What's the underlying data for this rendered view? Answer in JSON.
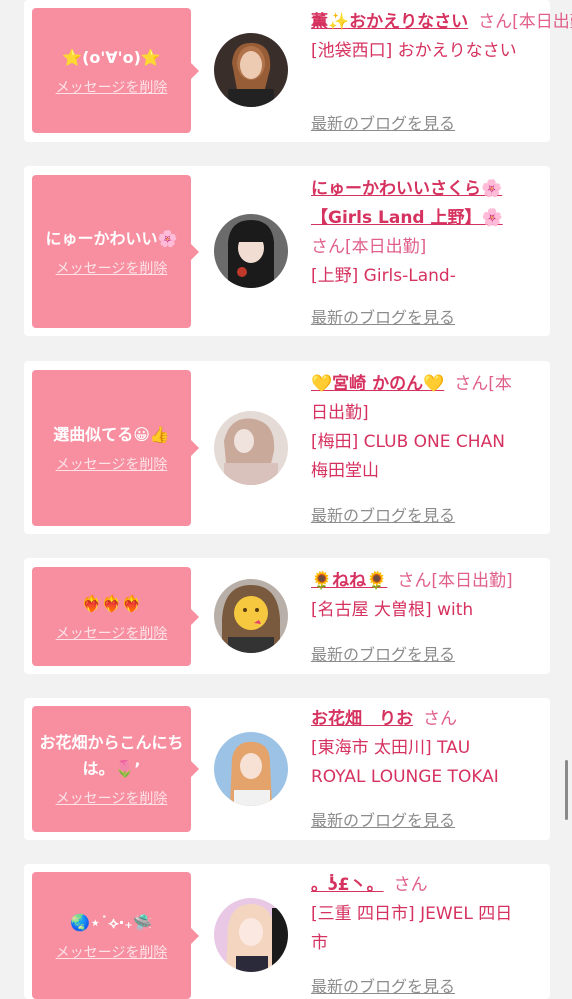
{
  "delete_label": "メッセージを削除",
  "blog_label": "最新のブログを見る",
  "san": "さん",
  "colors": {
    "accent": "#f78fa0",
    "name": "#d6325f",
    "background": "#f2f2f2"
  },
  "cards": [
    {
      "message": "⭐(o'∀'o)⭐",
      "name_lines": [
        "薫✨おかえりなさい"
      ],
      "info_lines": [
        "さん[本日出勤]",
        "[池袋西口] おかえりなさい"
      ]
    },
    {
      "message": "にゅーかわいい🌸",
      "name_lines": [
        "にゅーかわいいさくら🌸",
        "【Girls Land 上野】🌸"
      ],
      "info_lines": [
        "さん[本日出勤]",
        "[上野] Girls-Land-"
      ]
    },
    {
      "message": "選曲似てる😀👍",
      "name_lines": [
        "💛宮崎 かのん💛"
      ],
      "info_lines": [
        "さん[本",
        "日出勤]",
        "[梅田] CLUB ONE CHAN",
        "梅田堂山"
      ]
    },
    {
      "message": "❤️‍🔥❤️‍🔥❤️‍🔥",
      "name_lines": [
        "🌻ねね🌻"
      ],
      "info_lines": [
        "さん[本日出勤]",
        "[名古屋 大曽根] with"
      ]
    },
    {
      "message": "お花畑からこんにちは。🌷’",
      "name_lines": [
        "お花畑　りお"
      ],
      "info_lines": [
        "さん",
        "[東海市 太田川] TAU",
        "ROYAL LOUNGE TOKAI"
      ]
    },
    {
      "message": "🌏⋆˙⟡‧₊🛸",
      "name_lines": [
        "。ʖ̇£丶。"
      ],
      "info_lines": [
        "さん",
        "[三重 四日市] JEWEL 四日",
        "市"
      ]
    }
  ]
}
